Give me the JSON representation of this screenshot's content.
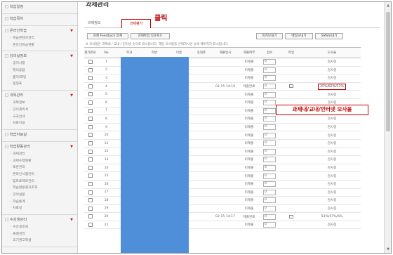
{
  "sidebar": {
    "sections": [
      {
        "label": "학습일정",
        "arrow": "",
        "subs": []
      },
      {
        "label": "학습목차",
        "arrow": "",
        "subs": []
      },
      {
        "label": "온라인학습",
        "arrow": "▼",
        "subs": [
          "학습콘텐츠관리",
          "온라인학습현황"
        ]
      },
      {
        "label": "강의실정보",
        "arrow": "▼",
        "subs": [
          "공지사항",
          "질의응답",
          "묻지/쪽팅",
          "일정표"
        ]
      },
      {
        "label": "과목관리",
        "arrow": "▼",
        "subs": [
          "과목정보",
          "강의계획서",
          "교과안내",
          "자료이용"
        ]
      },
      {
        "label": "학습자료실",
        "arrow": "",
        "subs": []
      },
      {
        "label": "학습활동관리",
        "arrow": "▼",
        "subs": [
          "과제관리",
          "과제수행현황",
          "토론관리",
          "온라인시험관리",
          "팀프로젝트관리",
          "학습활동평과조회",
          "강의설문",
          "학습통계",
          "자료실"
        ]
      },
      {
        "label": "수강생관리",
        "arrow": "▼",
        "subs": [
          "수강생조회",
          "출결관리",
          "조기경고학생"
        ]
      }
    ]
  },
  "main": {
    "title": "과제관리",
    "tabs": [
      "과제정보",
      "과제평가"
    ],
    "click_label": "클릭",
    "buttons_left": [
      "과제 Feedback 등록",
      "과제파일 다운로드"
    ],
    "buttons_right": [
      "쪽지보내기",
      "메일보내기",
      "SMS보내기"
    ],
    "notice": "※ 모사율은 과제내 / 교내 / 인터넷 순으로 표시됩니다. 해당 모사율을 선택하시면 상세 페이지가 표시됩니다.",
    "callout": "과제내/교내/인터넷 모사율",
    "columns": [
      "평가완료",
      "No",
      "학과",
      "학번",
      "이름",
      "휴대폰",
      "제출일시",
      "제출여부",
      "점수",
      "파일",
      "모사율"
    ]
  },
  "rows": [
    {
      "no": "1",
      "date": "",
      "status": "미제출",
      "plag": "검사중"
    },
    {
      "no": "2",
      "date": "",
      "status": "미제출",
      "plag": "검사중"
    },
    {
      "no": "3",
      "date": "",
      "status": "미제출",
      "plag": "검사중"
    },
    {
      "no": "4",
      "date": "02-15 14:19",
      "status": "제출완료",
      "plag": "25%/82%/21%"
    },
    {
      "no": "5",
      "date": "",
      "status": "미제출",
      "plag": "검사중"
    },
    {
      "no": "6",
      "date": "",
      "status": "미제출",
      "plag": "검사중"
    },
    {
      "no": "7",
      "date": "",
      "status": "미제출",
      "plag": "검사중"
    },
    {
      "no": "8",
      "date": "",
      "status": "미제출",
      "plag": "검사중"
    },
    {
      "no": "9",
      "date": "",
      "status": "미제출",
      "plag": "검사중"
    },
    {
      "no": "10",
      "date": "",
      "status": "미제출",
      "plag": "검사중"
    },
    {
      "no": "11",
      "date": "",
      "status": "미제출",
      "plag": "검사중"
    },
    {
      "no": "12",
      "date": "",
      "status": "미제출",
      "plag": "검사중"
    },
    {
      "no": "13",
      "date": "",
      "status": "미제출",
      "plag": "검사중"
    },
    {
      "no": "14",
      "date": "",
      "status": "미제출",
      "plag": "검사중"
    },
    {
      "no": "15",
      "date": "",
      "status": "미제출",
      "plag": "검사중"
    },
    {
      "no": "16",
      "date": "",
      "status": "미제출",
      "plag": "검사중"
    },
    {
      "no": "17",
      "date": "",
      "status": "미제출",
      "plag": "검사중"
    },
    {
      "no": "18",
      "date": "",
      "status": "미제출",
      "plag": "검사중"
    },
    {
      "no": "19",
      "date": "",
      "status": "미제출",
      "plag": "검사중"
    },
    {
      "no": "20",
      "date": "02-15 14:17",
      "status": "제출완료",
      "plag": "53%/57%/6%"
    },
    {
      "no": "21",
      "date": "",
      "status": "미제출",
      "plag": "검사중"
    }
  ],
  "colors": {
    "accent_red": "#c00000",
    "mask_blue": "#4f8fda"
  }
}
